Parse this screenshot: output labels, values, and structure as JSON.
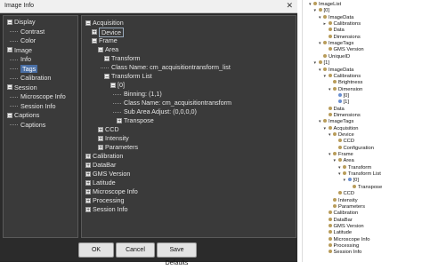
{
  "window": {
    "title": "Image Info",
    "close_glyph": "✕"
  },
  "left_tree": {
    "items": [
      {
        "label": "Display",
        "toggle": "−"
      },
      {
        "label": "Contrast"
      },
      {
        "label": "Color"
      },
      {
        "label": "Image",
        "toggle": "−"
      },
      {
        "label": "Info"
      },
      {
        "label": "Tags",
        "selected": true
      },
      {
        "label": "Calibration"
      },
      {
        "label": "Session",
        "toggle": "−"
      },
      {
        "label": "Microscope Info"
      },
      {
        "label": "Session Info"
      },
      {
        "label": "Captions",
        "toggle": "−"
      },
      {
        "label": "Captions"
      }
    ]
  },
  "tag_tree": {
    "items": [
      {
        "label": "Acquisition",
        "toggle": "−"
      },
      {
        "label": "Device",
        "toggle": "+",
        "highlighted": true
      },
      {
        "label": "Frame",
        "toggle": "−"
      },
      {
        "label": "Area",
        "toggle": "−"
      },
      {
        "label": "Transform",
        "toggle": "+"
      },
      {
        "label": "Class Name: cm_acquisitiontransform_list"
      },
      {
        "label": "Transform List",
        "toggle": "−"
      },
      {
        "label": "[0]",
        "toggle": "−"
      },
      {
        "label": "Binning: (1,1)"
      },
      {
        "label": "Class Name: cm_acquisitiontransform"
      },
      {
        "label": "Sub Area Adjust: (0,0,0,0)"
      },
      {
        "label": "Transpose",
        "toggle": "+"
      },
      {
        "label": "CCD",
        "toggle": "+"
      },
      {
        "label": "Intensity",
        "toggle": "+"
      },
      {
        "label": "Parameters",
        "toggle": "+"
      },
      {
        "label": "Calibration",
        "toggle": "+"
      },
      {
        "label": "DataBar",
        "toggle": "+"
      },
      {
        "label": "GMS Version",
        "toggle": "+"
      },
      {
        "label": "Latitude",
        "toggle": "+"
      },
      {
        "label": "Microscope Info",
        "toggle": "+"
      },
      {
        "label": "Processing",
        "toggle": "+"
      },
      {
        "label": "Session Info",
        "toggle": "+"
      }
    ]
  },
  "buttons": {
    "ok": "OK",
    "cancel": "Cancel",
    "save_defaults": "Save Defaults"
  },
  "side_tree": {
    "items": [
      {
        "label": "ImageList",
        "icon": "#b89c5a",
        "arrow": "▾"
      },
      {
        "label": "[0]",
        "icon": "#b89c5a",
        "arrow": "▾"
      },
      {
        "label": "ImageData",
        "icon": "#b89c5a",
        "arrow": "▾"
      },
      {
        "label": "Calibrations",
        "icon": "#b89c5a",
        "arrow": "▸"
      },
      {
        "label": "Data",
        "icon": "#b89c5a",
        "arrow": ""
      },
      {
        "label": "Dimensions",
        "icon": "#b89c5a",
        "arrow": ""
      },
      {
        "label": "ImageTags",
        "icon": "#b89c5a",
        "arrow": "▾"
      },
      {
        "label": "GMS Version",
        "icon": "#b89c5a",
        "arrow": ""
      },
      {
        "label": "UniqueID",
        "icon": "#b89c5a",
        "arrow": ""
      },
      {
        "label": "[1]",
        "icon": "#b89c5a",
        "arrow": "▾"
      },
      {
        "label": "ImageData",
        "icon": "#b89c5a",
        "arrow": "▾"
      },
      {
        "label": "Calibrations",
        "icon": "#b89c5a",
        "arrow": "▾"
      },
      {
        "label": "Brightness",
        "icon": "#b89c5a",
        "arrow": ""
      },
      {
        "label": "Dimension",
        "icon": "#b89c5a",
        "arrow": "▾"
      },
      {
        "label": "[0]",
        "icon": "#6a8fd0",
        "arrow": ""
      },
      {
        "label": "[1]",
        "icon": "#6a8fd0",
        "arrow": ""
      },
      {
        "label": "Data",
        "icon": "#b89c5a",
        "arrow": ""
      },
      {
        "label": "Dimensions",
        "icon": "#b89c5a",
        "arrow": ""
      },
      {
        "label": "ImageTags",
        "icon": "#b89c5a",
        "arrow": "▾"
      },
      {
        "label": "Acquisition",
        "icon": "#b89c5a",
        "arrow": "▾"
      },
      {
        "label": "Device",
        "icon": "#b89c5a",
        "arrow": "▾"
      },
      {
        "label": "CCD",
        "icon": "#b89c5a",
        "arrow": ""
      },
      {
        "label": "Configuration",
        "icon": "#b89c5a",
        "arrow": ""
      },
      {
        "label": "Frame",
        "icon": "#b89c5a",
        "arrow": "▾"
      },
      {
        "label": "Area",
        "icon": "#b89c5a",
        "arrow": "▾"
      },
      {
        "label": "Transform",
        "icon": "#b89c5a",
        "arrow": "▾"
      },
      {
        "label": "Transform List",
        "icon": "#b89c5a",
        "arrow": "▾"
      },
      {
        "label": "[0]",
        "icon": "#6a8fd0",
        "arrow": "▾"
      },
      {
        "label": "Transpose",
        "icon": "#b89c5a",
        "arrow": ""
      },
      {
        "label": "CCD",
        "icon": "#b89c5a",
        "arrow": ""
      },
      {
        "label": "Intensity",
        "icon": "#b89c5a",
        "arrow": ""
      },
      {
        "label": "Parameters",
        "icon": "#b89c5a",
        "arrow": ""
      },
      {
        "label": "Calibration",
        "icon": "#b89c5a",
        "arrow": ""
      },
      {
        "label": "DataBar",
        "icon": "#b89c5a",
        "arrow": ""
      },
      {
        "label": "GMS Version",
        "icon": "#b89c5a",
        "arrow": ""
      },
      {
        "label": "Latitude",
        "icon": "#b89c5a",
        "arrow": ""
      },
      {
        "label": "Microscope Info",
        "icon": "#b89c5a",
        "arrow": ""
      },
      {
        "label": "Processing",
        "icon": "#b89c5a",
        "arrow": ""
      },
      {
        "label": "Session Info",
        "icon": "#b89c5a",
        "arrow": ""
      }
    ]
  },
  "colors": {
    "dialog_bg": "#2b2b2b",
    "panel_bg": "#3a3a3a",
    "selection": "#4a6fa5",
    "tree_icon": "#b89c5a"
  }
}
